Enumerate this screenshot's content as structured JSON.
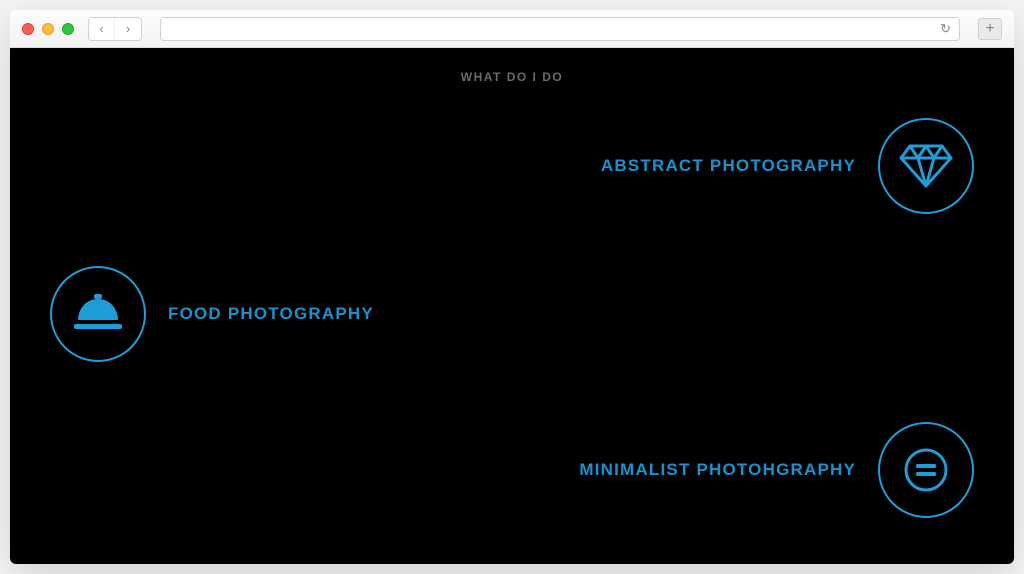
{
  "heading": "WHAT DO I DO",
  "services": {
    "abstract": {
      "label": "ABSTRACT PHOTOGRAPHY",
      "icon": "diamond-icon"
    },
    "food": {
      "label": "FOOD PHOTOGRAPHY",
      "icon": "bell-icon"
    },
    "minimal": {
      "label": "MINIMALIST PHOTOHGRAPHY",
      "icon": "equals-icon"
    }
  },
  "accent_color": "#1e9dd8"
}
